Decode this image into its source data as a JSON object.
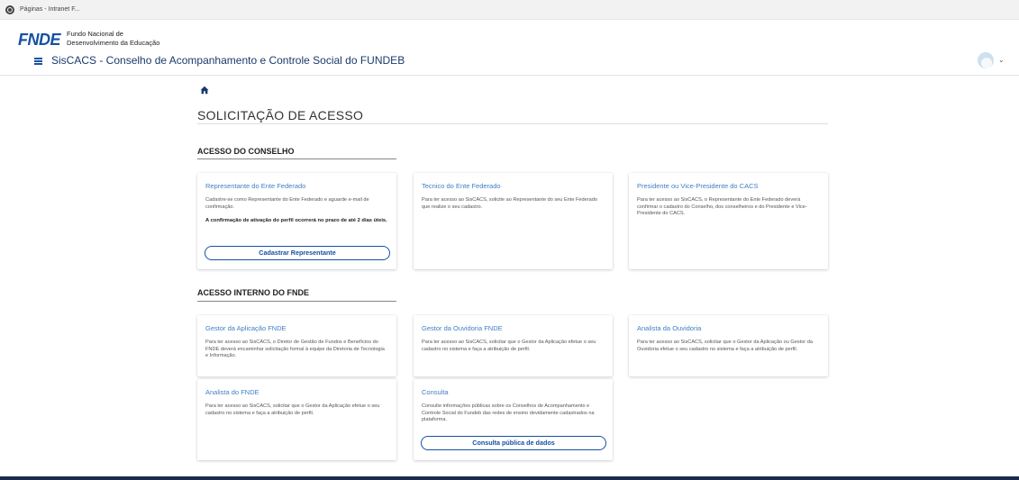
{
  "browser_tab": {
    "title": "Páginas - Intranet F..."
  },
  "header": {
    "logo_mark": "FNDE",
    "logo_line1": "Fundo Nacional de",
    "logo_line2": "Desenvolvimento da Educação",
    "app_title": "SisCACS - Conselho de Acompanhamento e Controle Social do FUNDEB",
    "menu_icon": "hamburger-icon",
    "avatar_icon": "avatar",
    "avatar_caret": "⌄"
  },
  "page": {
    "title": "SOLICITAÇÃO DE ACESSO",
    "home_icon": "home-icon"
  },
  "section_conselho": {
    "title": "ACESSO DO CONSELHO",
    "cards": [
      {
        "title": "Representante do Ente Federado",
        "text": "Cadastre-se como Representante do Ente Federado e aguarde e-mail de confirmação.",
        "note": "A confirmação de ativação do perfil ocorrerá no prazo de até 2 dias úteis.",
        "button": "Cadastrar Representante"
      },
      {
        "title": "Tecnico do Ente Federado",
        "text": "Para ter acesso ao SisCACS, solicite ao Representante do seu Ente Federado que realize o seu cadastro."
      },
      {
        "title": "Presidente ou Vice-Presidente do CACS",
        "text": "Para ter acesso ao SisCACS, o Representante do Ente Federado deverá confirmar o cadastro do Conselho, dos conselheiros e do Presidente e Vice-Presidente do CACS."
      }
    ]
  },
  "section_interno": {
    "title": "ACESSO INTERNO DO FNDE",
    "cards": [
      {
        "title": "Gestor da Aplicação FNDE",
        "text": "Para ter acesso ao SisCACS, o Diretor de Gestão de Fundos e Benefícios do FNDE deverá encaminhar solicitação formal à equipe da Diretoria de Tecnologia e Informação."
      },
      {
        "title": "Gestor da Ouvidoria FNDE",
        "text": "Para ter acesso ao SisCACS, solicitar que o Gestor da Aplicação efetue o seu cadastro no sistema e faça a atribuição de perfil."
      },
      {
        "title": "Analista da Ouvidoria",
        "text": "Para ter acesso ao SisCACS, solicitar que o Gestor da Aplicação ou Gestor da Ouvidoria efetue o seu cadastro no sistema e faça a atribuição de perfil."
      },
      {
        "title": "Analista do FNDE",
        "text": "Para ter acesso ao SisCACS, solicitar que o Gestor da Aplicação efetue o seu cadastro no sistema e faça a atribuição de perfil."
      },
      {
        "title": "Consulta",
        "text": "Consulte informações públicas sobre os Conselhos de Acompanhamento e Controle Social do Fundeb das redes de ensino devidamente cadastrados na plataforma.",
        "button": "Consulta pública de dados"
      }
    ]
  },
  "colors": {
    "brand": "#1651a1",
    "link": "#3f7fc4",
    "footer": "#1b2a4a"
  }
}
